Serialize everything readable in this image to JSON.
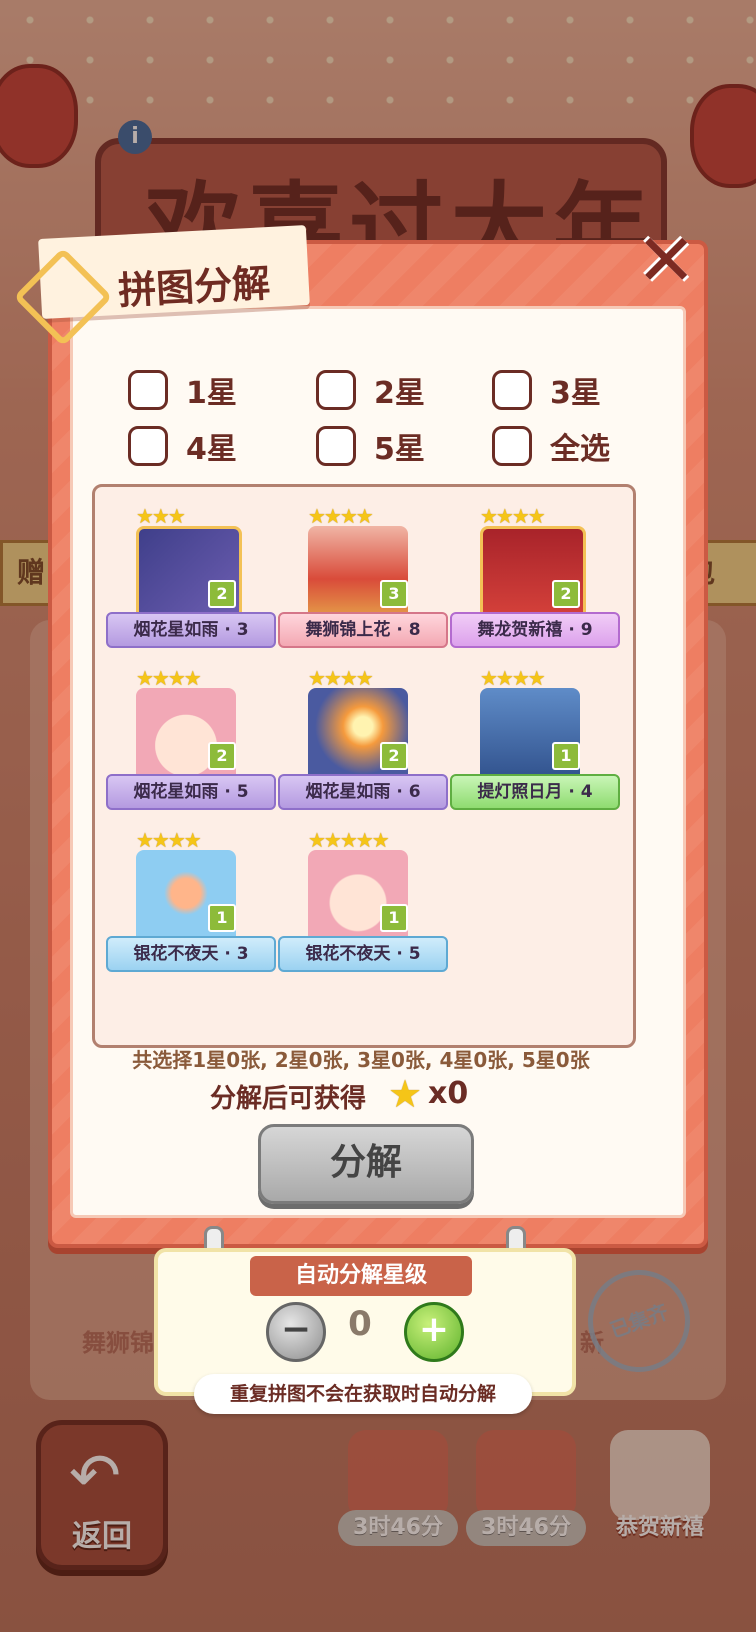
{
  "background": {
    "title": "欢喜过大年",
    "info_icon": "i",
    "left_banner": "赠",
    "right_banner": "包",
    "card_label_left": "舞狮锦",
    "card_label_right": "新",
    "complete_badge": "已集齐",
    "back_button": "返回",
    "bottom_items": [
      {
        "label": "3时46分"
      },
      {
        "label": "3时46分"
      },
      {
        "label": "恭贺新禧"
      }
    ]
  },
  "modal": {
    "title": "拼图分解",
    "close_icon": "✕",
    "filters": [
      {
        "label": "1星",
        "checked": false
      },
      {
        "label": "2星",
        "checked": false
      },
      {
        "label": "3星",
        "checked": false
      },
      {
        "label": "4星",
        "checked": false
      },
      {
        "label": "5星",
        "checked": false
      },
      {
        "label": "全选",
        "checked": false
      }
    ],
    "pieces": [
      {
        "stars": "★★★",
        "count": "2",
        "name": "烟花星如雨 · 3"
      },
      {
        "stars": "★★★★",
        "count": "3",
        "name": "舞狮锦上花 · 8"
      },
      {
        "stars": "★★★★",
        "count": "2",
        "name": "舞龙贺新禧 · 9"
      },
      {
        "stars": "★★★★",
        "count": "2",
        "name": "烟花星如雨 · 5"
      },
      {
        "stars": "★★★★",
        "count": "2",
        "name": "烟花星如雨 · 6"
      },
      {
        "stars": "★★★★",
        "count": "1",
        "name": "提灯照日月 · 4"
      },
      {
        "stars": "★★★★",
        "count": "1",
        "name": "银花不夜天 · 3"
      },
      {
        "stars": "★★★★★",
        "count": "1",
        "name": "银花不夜天 · 5"
      }
    ],
    "summary": "共选择1星0张, 2星0张, 3星0张, 4星0张, 5星0张",
    "reward_label": "分解后可获得",
    "reward_star_icon": "★",
    "reward_count": "x0",
    "decompose_button": "分解"
  },
  "auto_panel": {
    "title": "自动分解星级",
    "minus": "−",
    "plus": "+",
    "level": "0",
    "note": "重复拼图不会在获取时自动分解"
  },
  "colors": {
    "accent": "#ee7e62",
    "text_dark": "#6b2c24",
    "plus_green": "#5fb32d"
  }
}
